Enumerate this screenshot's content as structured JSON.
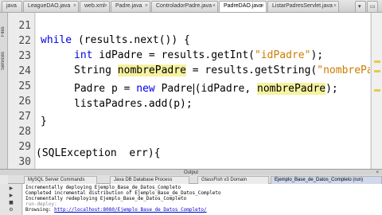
{
  "tabs": [
    {
      "label": "java",
      "active": false
    },
    {
      "label": "LeagueDAO.java",
      "active": false
    },
    {
      "label": "web.xml",
      "active": false
    },
    {
      "label": "Padre.java",
      "active": false
    },
    {
      "label": "ControladorPadre.java",
      "active": false
    },
    {
      "label": "PadreDAO.java",
      "active": true
    },
    {
      "label": "ListarPadresServlet.java",
      "active": false
    }
  ],
  "side_tabs": [
    "Services",
    "Files"
  ],
  "editor": {
    "line_numbers": [
      "21",
      "22",
      "23",
      "24",
      "25",
      "26",
      "27",
      "28",
      "29",
      "30"
    ],
    "lines": [
      "while (results.next()) {",
      "int idPadre = results.getInt(\"idPadre\");",
      "String nombrePadre = results.getString(\"nombrePadre\");",
      "Padre p = new Padre(idPadre, nombrePadre);",
      "listaPadres.add(p);",
      "}",
      "",
      "(SQLException err){"
    ],
    "tokens": {
      "while": "while",
      "results_next": " (results.next()) {",
      "int": "int",
      "idPadre_decl": " idPadre = results.getInt(",
      "str_idPadre": "\"idPadre\"",
      "close_paren_semi": ");",
      "String": "String ",
      "nombrePadre": "nombrePadre",
      "assign_getString": " = results.getString(",
      "str_nombrePadre": "\"nombrePadre\"",
      "Padre_p": "Padre p = ",
      "new": "new",
      "Padre_ctor": " Padre",
      "ctor_args": "(idPadre, ",
      "close_ctor": ");",
      "lista_add": "listaPadres.add(p);",
      "brace_close": "}",
      "catch_line": "(SQLException  err){"
    }
  },
  "output": {
    "title": "Output",
    "close": "×",
    "tabs": [
      "MySQL Server Commands",
      "Java DB Database Process",
      "GlassFish v3 Domain",
      "Ejemplo_Base_de_Datos_Completo (run)"
    ],
    "lines": [
      "Incrementally deploying Ejemplo_Base_de_Datos_Completo",
      "Completed incremental distribution of Ejemplo_Base_de_Datos_Completo",
      "Incrementally redeploying Ejemplo_Base_de_Datos_Completo",
      "run-deploy:",
      "Browsing: ",
      "http://localhost:8080/Ejemplo_Base_de_Datos_Completo/"
    ]
  },
  "colors": {
    "keyword": "#0000e6",
    "string": "#ce7b00",
    "highlight": "#f5f2a0"
  }
}
